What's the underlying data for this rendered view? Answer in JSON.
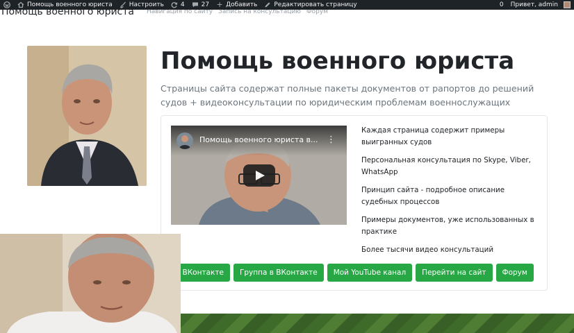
{
  "admin_bar": {
    "site_name": "Помощь военного юриста",
    "customize": "Настроить",
    "updates_count": "4",
    "comments_count": "27",
    "add_new": "Добавить",
    "edit_page": "Редактировать страницу",
    "notifications_count": "0",
    "greeting": "Привет, admin"
  },
  "topnav": {
    "brand": "Помощь военного юриста",
    "links": [
      "Навигация по сайту",
      "Запись на консультацию",
      "Форум"
    ]
  },
  "hero": {
    "title": "Помощь военного юриста",
    "subtitle": "Страницы сайта содержат полные пакеты документов от рапортов до решений судов + видеоконсультации по юридическим проблемам военнослужащих"
  },
  "video": {
    "title": "Помощь военного юриста в...",
    "icons": {
      "play": "play-icon",
      "menu": "more-vertical-icon"
    }
  },
  "features": [
    "Каждая страница содержит примеры выигранных судов",
    "Персональная консультация по Skype, Viber, WhatsApp",
    "Принцип сайта - подробное описание судебных процессов",
    "Примеры документов, уже использованных в практике",
    "Более тысячи видео консультаций"
  ],
  "buttons": [
    "в ВКонтакте",
    "Группа в ВКонтакте",
    "Мой YouTube канал",
    "Перейти на сайт",
    "Форум"
  ],
  "colors": {
    "admin_bar_bg": "#1d2327",
    "button_green": "#28a745",
    "title_text": "#212529",
    "muted_text": "#6c757d"
  }
}
